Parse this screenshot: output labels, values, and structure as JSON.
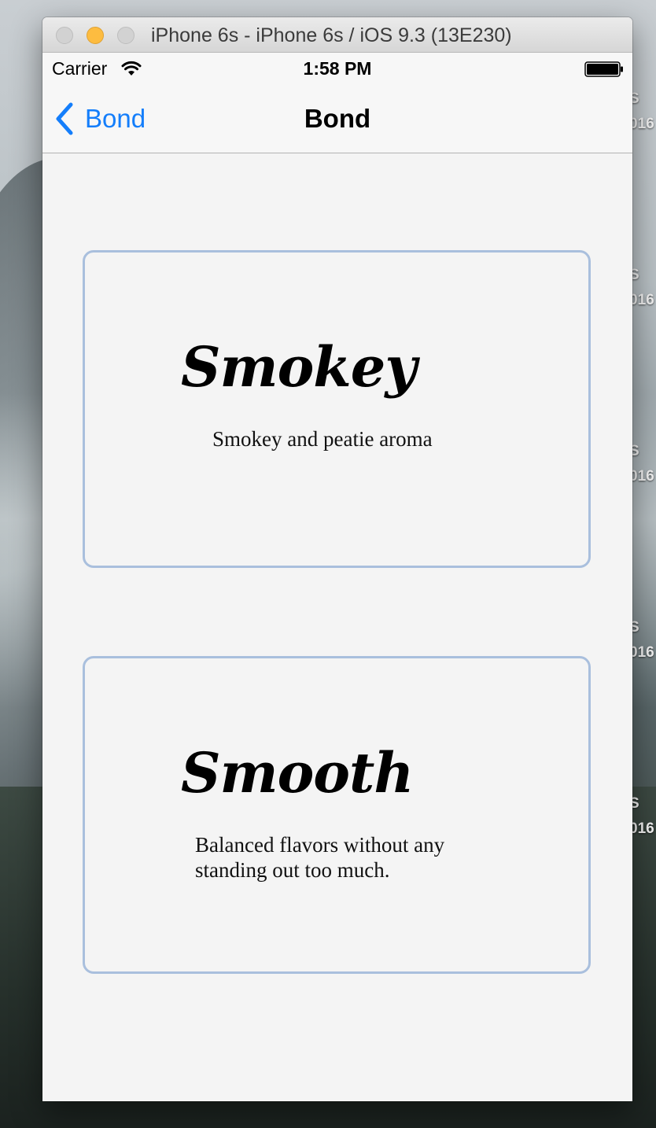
{
  "simulator": {
    "window_title": "iPhone 6s - iPhone 6s / iOS 9.3 (13E230)"
  },
  "status_bar": {
    "carrier": "Carrier",
    "time": "1:58 PM"
  },
  "nav_bar": {
    "back_label": "Bond",
    "title": "Bond"
  },
  "cards": [
    {
      "title": "Smokey",
      "description": "Smokey and peatie aroma"
    },
    {
      "title": "Smooth",
      "description": "Balanced flavors without any standing out too much."
    }
  ],
  "desktop": {
    "icon_labels": [
      "S",
      "016",
      "S",
      "016",
      "S",
      "016",
      "S",
      "016",
      "S",
      "016"
    ]
  },
  "colors": {
    "tint": "#147efb",
    "card_border": "#a9bfdd",
    "background": "#f4f4f4"
  }
}
